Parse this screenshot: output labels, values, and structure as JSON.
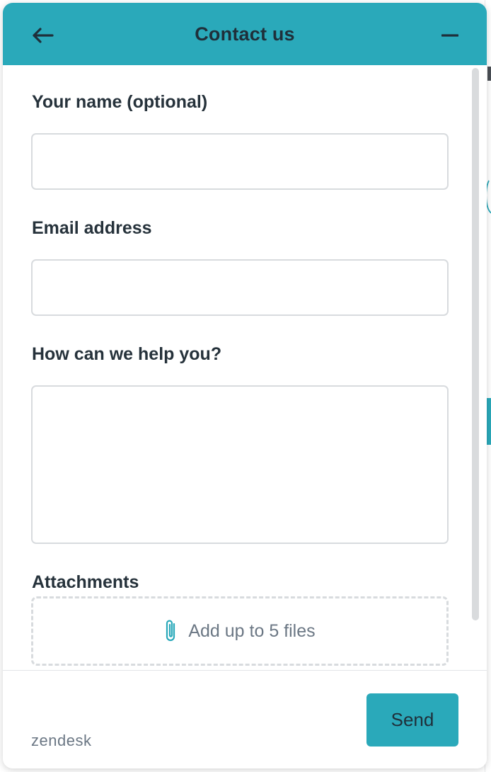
{
  "header": {
    "title": "Contact us",
    "back_icon": "arrow-left-icon",
    "minimize_icon": "minimize-icon"
  },
  "form": {
    "name": {
      "label": "Your name (optional)",
      "value": ""
    },
    "email": {
      "label": "Email address",
      "value": ""
    },
    "message": {
      "label": "How can we help you?",
      "value": ""
    },
    "attachments": {
      "label": "Attachments",
      "dropzone_text": "Add up to 5 files",
      "icon": "paperclip-icon"
    }
  },
  "footer": {
    "brand": "zendesk",
    "send_label": "Send"
  },
  "colors": {
    "accent": "#2aa9ba",
    "text": "#26323b",
    "muted": "#6b7784",
    "border": "#d8dbde"
  }
}
